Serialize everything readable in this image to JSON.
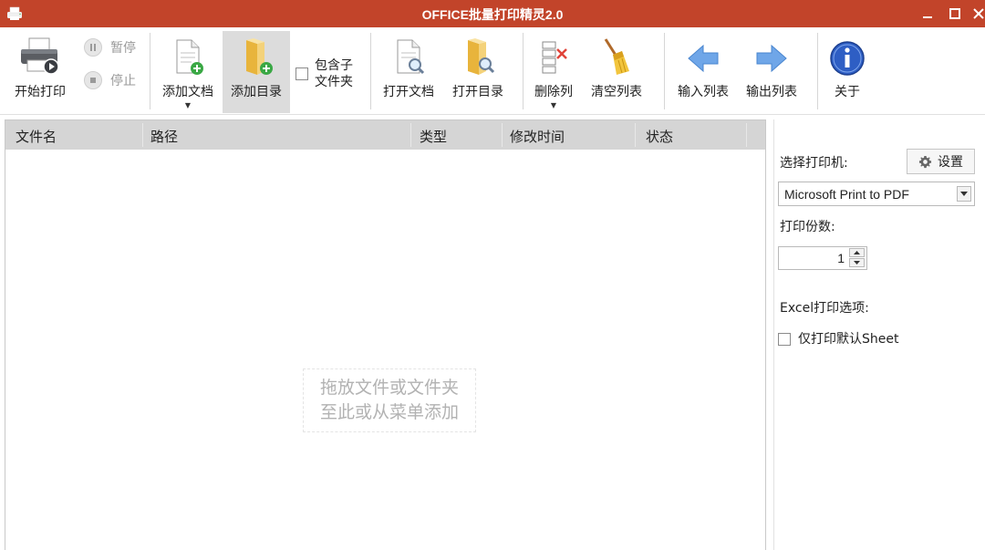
{
  "window": {
    "title": "OFFICE批量打印精灵2.0",
    "title_bar_color": "#c2442a"
  },
  "toolbar": {
    "start_print": "开始打印",
    "pause": "暂停",
    "stop": "停止",
    "add_document": "添加文档",
    "add_folder": "添加目录",
    "include_subfolders_line1": "包含子",
    "include_subfolders_line2": "文件夹",
    "open_document": "打开文档",
    "open_folder": "打开目录",
    "delete_column": "删除列",
    "clear_list": "清空列表",
    "import_list": "输入列表",
    "export_list": "输出列表",
    "about": "关于"
  },
  "filelist": {
    "columns": [
      "文件名",
      "路径",
      "类型",
      "修改时间",
      "状态"
    ],
    "header_color": "#d5d5d5",
    "drop_hint_line1": "拖放文件或文件夹",
    "drop_hint_line2": "至此或从菜单添加"
  },
  "settings": {
    "select_printer_label": "选择打印机:",
    "settings_button": "设置",
    "printer_selected": "Microsoft Print to PDF",
    "copies_label": "打印份数:",
    "copies_value": "1",
    "excel_options_label": "Excel打印选项:",
    "default_sheet_only": "仅打印默认Sheet"
  }
}
